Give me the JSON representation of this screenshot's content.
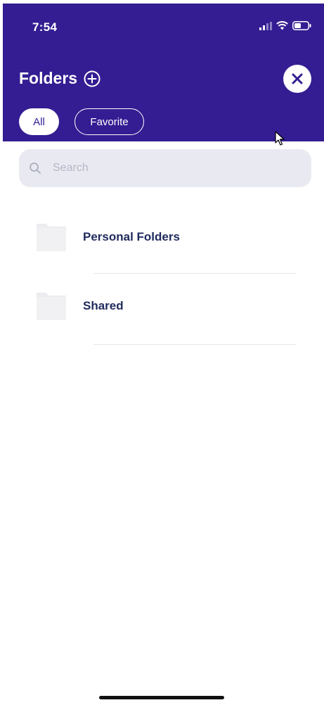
{
  "status_bar": {
    "time": "7:54",
    "icons": [
      "cellular-signal-icon",
      "wifi-icon",
      "battery-icon"
    ]
  },
  "header": {
    "title": "Folders",
    "add_icon": "plus-circle-icon",
    "close_icon": "close-icon",
    "background_color": "#341d92"
  },
  "tabs": [
    {
      "label": "All",
      "selected": true
    },
    {
      "label": "Favorite",
      "selected": false
    }
  ],
  "search": {
    "placeholder": "Search",
    "value": "",
    "icon": "search-icon"
  },
  "folders": [
    {
      "label": "Personal Folders",
      "icon": "folder-icon"
    },
    {
      "label": "Shared",
      "icon": "folder-icon"
    }
  ]
}
